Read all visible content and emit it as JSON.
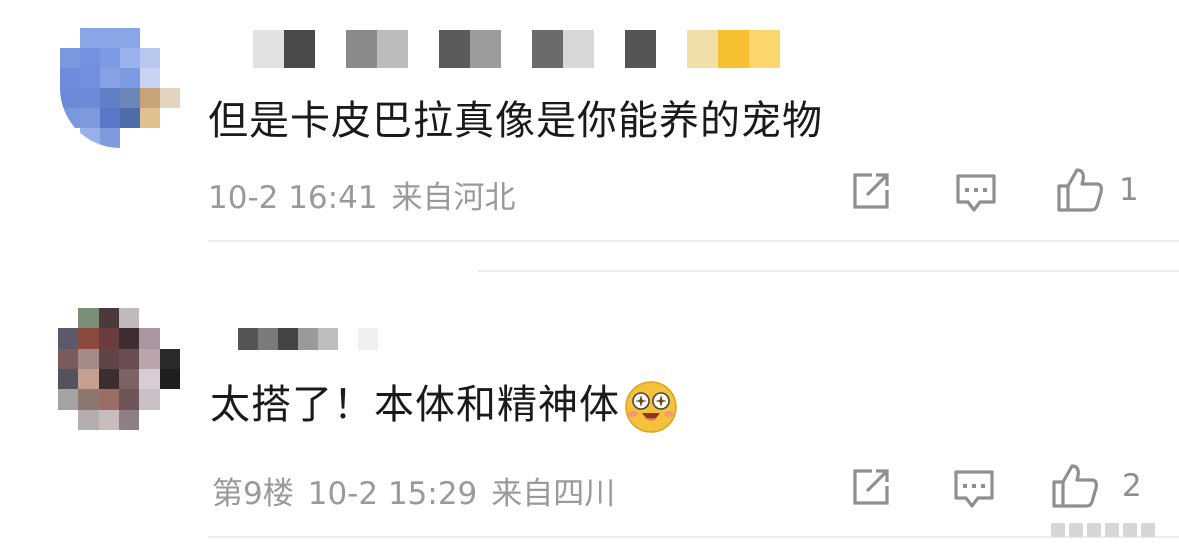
{
  "comments": [
    {
      "text": "但是卡皮巴拉真像是你能养的宠物",
      "floor": "",
      "date": "10-2 16:41",
      "location": "来自河北",
      "like_count": "1",
      "avatar_colors": [
        "#ffffff",
        "#8aa6e6",
        "#8aa6e6",
        "#8aa6e6",
        "#ffffff",
        "#ffffff",
        "#7a98e0",
        "#7391de",
        "#7c9be3",
        "#9bb3ec",
        "#b8c7ef",
        "#ffffff",
        "#6f8cdc",
        "#7191e0",
        "#86a1e5",
        "#7c9ce1",
        "#c7d3f1",
        "#ffffff",
        "#6c89d8",
        "#6b8bd8",
        "#5f7fc8",
        "#6d86b8",
        "#c9a47a",
        "#e1d3bd",
        "#7b97dd",
        "#7e9adf",
        "#5a78c7",
        "#4f6ea9",
        "#e0c08e",
        "#ffffff",
        "#ffffff",
        "#9ab0ea",
        "#7f9bde",
        "#ffffff",
        "#ffffff",
        "#ffffff"
      ],
      "username_colors": [
        "#ffffff",
        "#e2e2e2",
        "#4a4a4a",
        "#ffffff",
        "#8a8a8a",
        "#bcbcbc",
        "#ffffff",
        "#5a5a5a",
        "#9c9c9c",
        "#ffffff",
        "#6b6b6b",
        "#d8d8d8",
        "#ffffff",
        "#555555",
        "#ffffff",
        "#f1dfa8",
        "#f7c033",
        "#fbd66a"
      ]
    },
    {
      "text": "太搭了！本体和精神体",
      "floor": "第9楼",
      "date": "10-2 15:29",
      "location": "来自四川",
      "like_count": "2",
      "avatar_colors": [
        "#ffffff",
        "#7b8f77",
        "#4b3a3c",
        "#c2b9bd",
        "#ffffff",
        "#ffffff",
        "#5b5a6a",
        "#8b4a3b",
        "#6b3d3e",
        "#3e2c31",
        "#a897a1",
        "#ffffff",
        "#7b5a5c",
        "#a38a86",
        "#5f4548",
        "#6a4d52",
        "#b9a4ad",
        "#2a2a2a",
        "#55525f",
        "#c5a08e",
        "#3c2d31",
        "#7d6264",
        "#d8cdd4",
        "#1e1e1e",
        "#a3a3a3",
        "#8e7671",
        "#9a6e66",
        "#6f5458",
        "#c8c1c7",
        "#ffffff",
        "#ffffff",
        "#b5aeb0",
        "#c9bcbd",
        "#8d7f84",
        "#ffffff",
        "#ffffff"
      ],
      "username_colors": [
        "#ffffff",
        "#555555",
        "#7a7a7a",
        "#444444",
        "#9a9a9a",
        "#bdbdbd",
        "#ffffff",
        "#f0f0f0"
      ]
    }
  ],
  "icons": {
    "share": "share-icon",
    "reply": "comment-icon",
    "like": "thumbs-up-icon",
    "emoji": "starry-eyed-emoji-icon",
    "watermark": "weibo-watermark-icon"
  },
  "colors": {
    "text": "#1a1a1a",
    "meta": "#9a9a9a",
    "divider": "#ececec"
  }
}
